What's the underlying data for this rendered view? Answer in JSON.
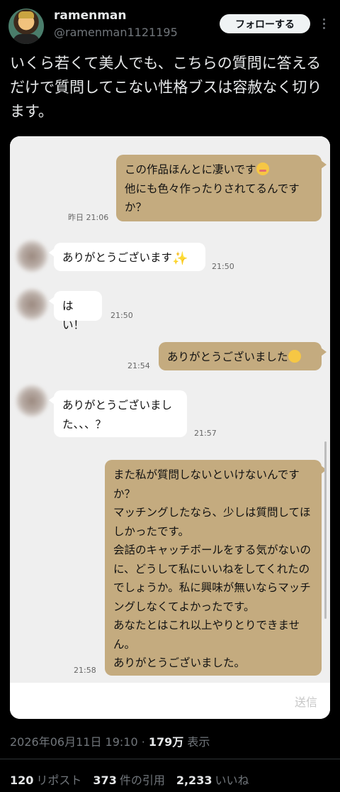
{
  "user": {
    "name": "ramenman",
    "handle": "@ramenman1121195",
    "follow_label": "フォローする"
  },
  "tweet": {
    "text": "いくら若くて美人でも、こちらの質問に答えるだけで質問してこない性格ブスは容赦なく切ります。"
  },
  "chat": {
    "messages": [
      {
        "side": "me",
        "line1": "この作品ほんとに凄いです",
        "line2": "他にも色々作ったりされてるんですか？",
        "time": "昨日 21:06",
        "emoji": "flushed-face-emoji"
      },
      {
        "side": "them",
        "text": "ありがとうございます",
        "time": "21:50",
        "emoji": "sparkles-emoji"
      },
      {
        "side": "them",
        "text": "はい！",
        "time": "21:50"
      },
      {
        "side": "me",
        "text": "ありがとうございました",
        "time": "21:54",
        "emoji": "smiling-face-emoji"
      },
      {
        "side": "them",
        "text": "ありがとうございました、、、？",
        "time": "21:57"
      },
      {
        "side": "me",
        "paragraphs": [
          "また私が質問しないといけないんですか？",
          "マッチングしたなら、少しは質問してほしかったです。",
          "会話のキャッチボールをする気がないのに、どうして私にいいねをしてくれたのでしょうか。私に興味が無いならマッチングしなくてよかったです。",
          "あなたとはこれ以上やりとりできません。",
          "ありがとうございました。"
        ],
        "time": "21:58"
      }
    ],
    "send_label": "送信"
  },
  "meta": {
    "datetime": "2026年06月11日 19:10",
    "views_count": "179万",
    "views_label": "表示"
  },
  "stats": {
    "reposts_count": "120",
    "reposts_label": "リポスト",
    "quotes_count": "373",
    "quotes_label": "件の引用",
    "likes_count": "2,233",
    "likes_label": "いいね"
  },
  "colors": {
    "my_bubble": "#c4ab7f",
    "their_bubble": "#ffffff",
    "chat_bg": "#efefef"
  }
}
